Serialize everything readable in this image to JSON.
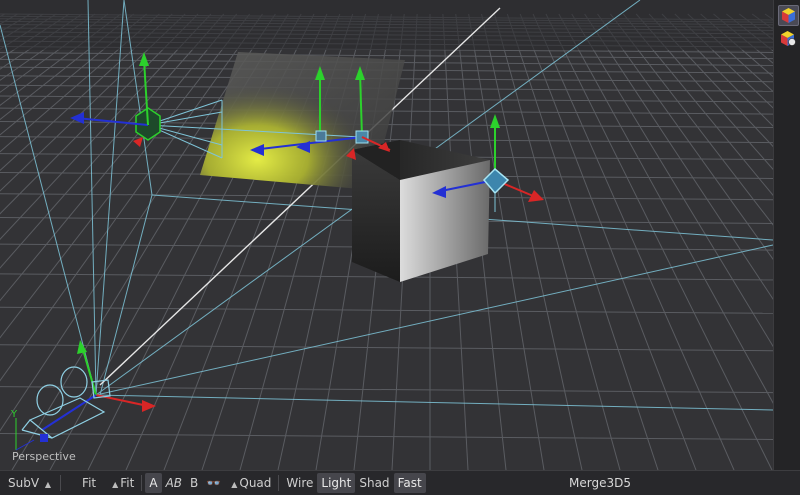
{
  "viewport": {
    "label": "Perspective",
    "axis_label": "Y"
  },
  "toolbar": {
    "subv": "SubV",
    "fit1": "Fit",
    "fit2": "Fit",
    "a": "A",
    "ab": "AB",
    "b": "B",
    "quad": "Quad",
    "wire": "Wire",
    "light": "Light",
    "shad": "Shad",
    "fast": "Fast",
    "node": "Merge3D5"
  },
  "right_panel": {
    "icons": [
      "cube-3d-icon",
      "sphere-3d-icon"
    ]
  },
  "colors": {
    "viewport_bg": "#333336",
    "grid": "#595b60",
    "wire": "#7ec4d8",
    "axis_x": "#d92626",
    "axis_y": "#2cd12c",
    "axis_z": "#2330d4",
    "spot_glow": "#d8e048"
  }
}
